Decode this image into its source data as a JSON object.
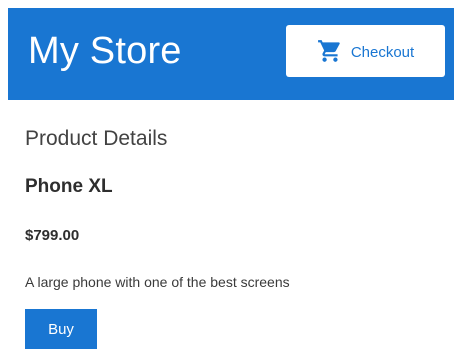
{
  "header": {
    "title": "My Store",
    "checkout_label": "Checkout",
    "checkout_icon": "shopping-cart-icon"
  },
  "main": {
    "section_title": "Product Details",
    "product": {
      "name": "Phone XL",
      "price": "$799.00",
      "description": "A large phone with one of the best screens",
      "buy_label": "Buy"
    }
  },
  "colors": {
    "primary": "#1976d2",
    "background": "#ffffff"
  }
}
